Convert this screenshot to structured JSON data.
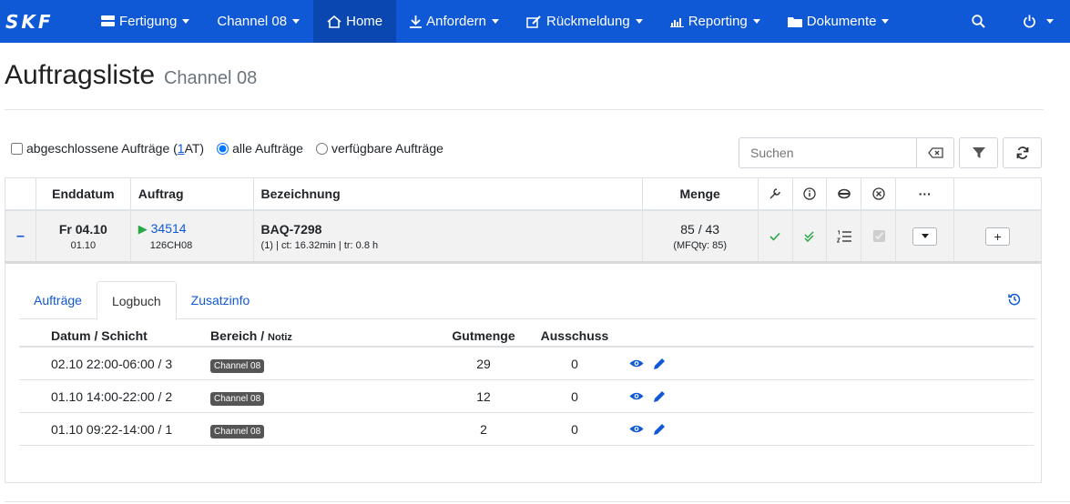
{
  "nav": {
    "brand": "SKF",
    "items": [
      {
        "label": "Fertigung",
        "icon": "server-icon"
      },
      {
        "label": "Channel 08",
        "icon": ""
      },
      {
        "label": "Home",
        "icon": "home-icon"
      },
      {
        "label": "Anfordern",
        "icon": "download-icon"
      },
      {
        "label": "Rückmeldung",
        "icon": "edit-icon"
      },
      {
        "label": "Reporting",
        "icon": "chart-icon"
      },
      {
        "label": "Dokumente",
        "icon": "folder-icon"
      }
    ]
  },
  "header": {
    "title": "Auftragsliste",
    "subtitle": "Channel 08"
  },
  "filters": {
    "closed_label": "abgeschlossene Aufträge (",
    "closed_count": "1",
    "closed_suffix": " AT)",
    "all_label": "alle Aufträge",
    "available_label": "verfügbare Aufträge",
    "search_placeholder": "Suchen"
  },
  "table": {
    "headers": {
      "enddatum": "Enddatum",
      "auftrag": "Auftrag",
      "bezeichnung": "Bezeichnung",
      "menge": "Menge",
      "more": "···"
    },
    "row": {
      "toggle": "–",
      "day": "Fr 04.10",
      "date": "01.10",
      "order_no": "34514",
      "order_code": "126CH08",
      "name": "BAQ-7298",
      "detail": "(1) | ct: 16.32min | tr: 0.8 h",
      "qty": "85 / 43",
      "mfqty": "(MFQty: 85)",
      "add": "+"
    }
  },
  "detail": {
    "tabs": [
      "Aufträge",
      "Logbuch",
      "Zusatzinfo"
    ],
    "active_tab": "Logbuch",
    "log_headers": {
      "datum": "Datum / Schicht",
      "bereich": "Bereich / ",
      "notiz": "Notiz",
      "gutmenge": "Gutmenge",
      "ausschuss": "Ausschuss"
    },
    "log_rows": [
      {
        "datum": "02.10 22:00-06:00 / 3",
        "bereich": "Channel 08",
        "gutmenge": "29",
        "ausschuss": "0"
      },
      {
        "datum": "01.10 14:00-22:00 / 2",
        "bereich": "Channel 08",
        "gutmenge": "12",
        "ausschuss": "0"
      },
      {
        "datum": "01.10 09:22-14:00 / 1",
        "bereich": "Channel 08",
        "gutmenge": "2",
        "ausschuss": "0"
      }
    ]
  },
  "colors": {
    "nav": "#0f58d6",
    "nav_active": "#0a47b0",
    "link": "#0f58d6",
    "success": "#28a745"
  }
}
